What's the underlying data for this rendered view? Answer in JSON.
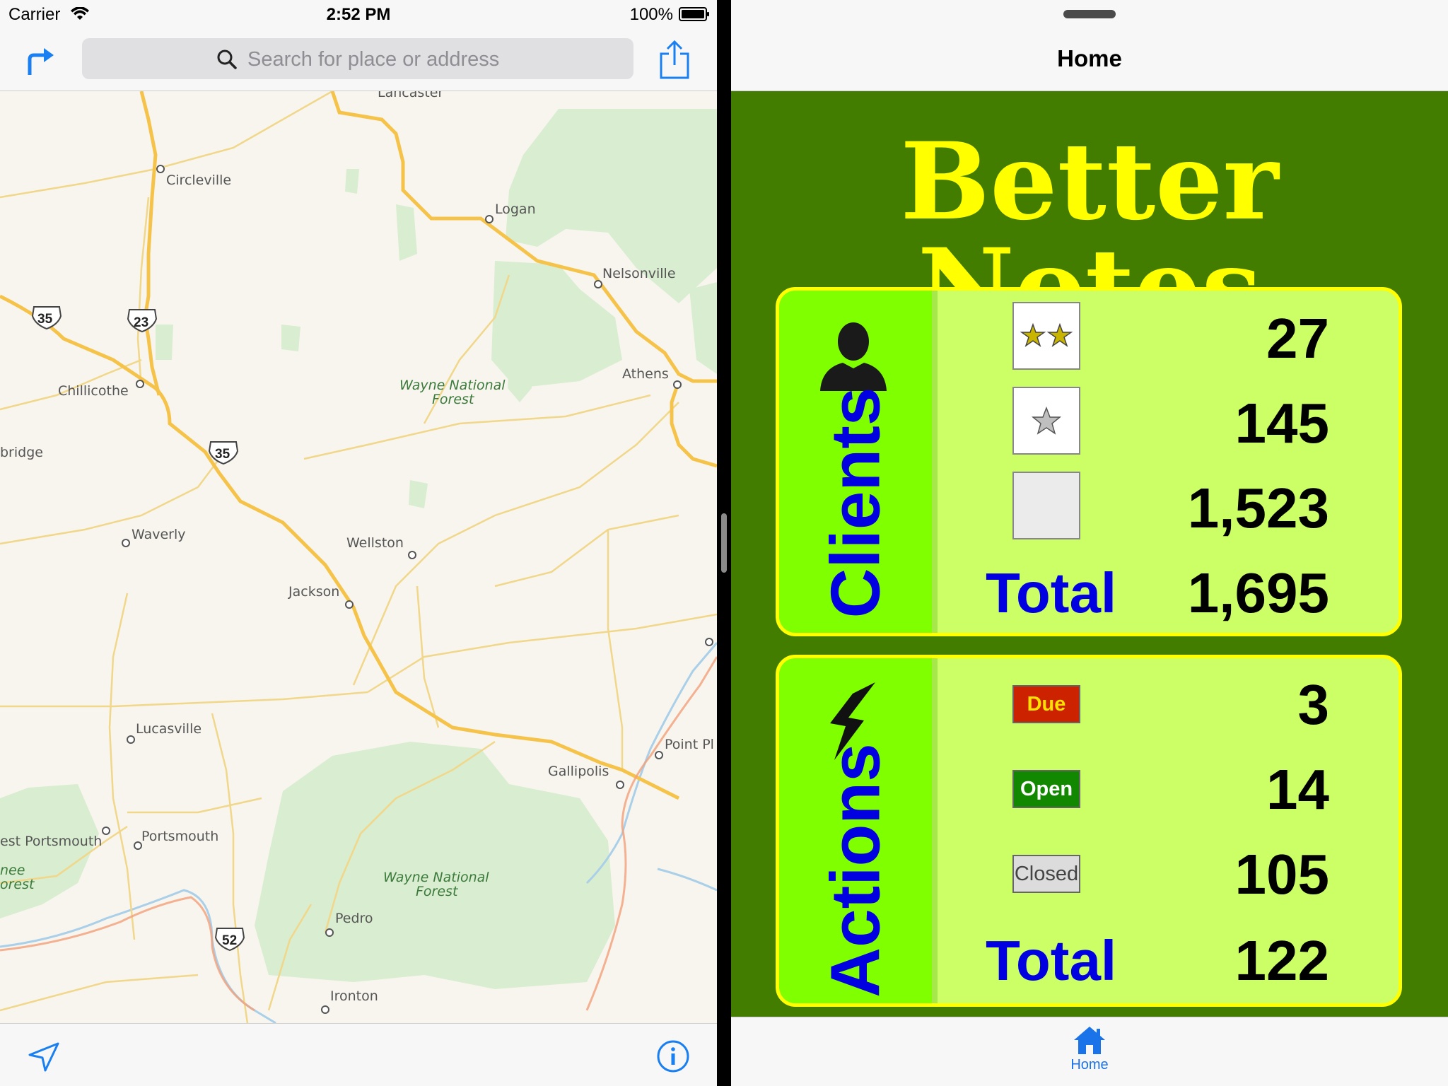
{
  "status_bar": {
    "carrier": "Carrier",
    "time": "2:52 PM",
    "battery": "100%"
  },
  "maps": {
    "search_placeholder": "Search for place or address",
    "places": {
      "lancaster": "Lancaster",
      "circleville": "Circleville",
      "logan": "Logan",
      "nelsonville": "Nelsonville",
      "chillicothe": "Chillicothe",
      "athens": "Athens",
      "bridge": "bridge",
      "waverly": "Waverly",
      "wellston": "Wellston",
      "jackson": "Jackson",
      "lucasville": "Lucasville",
      "point": "Point Pl",
      "gallipolis": "Gallipolis",
      "west_portsmouth": "est Portsmouth",
      "portsmouth": "Portsmouth",
      "pedro": "Pedro",
      "ironton": "Ironton",
      "nee": "nee",
      "orest": "orest"
    },
    "forests": {
      "north_line1": "Wayne National",
      "north_line2": "Forest",
      "south_line1": "Wayne National",
      "south_line2": "Forest"
    },
    "shields": {
      "r35a": "35",
      "r23": "23",
      "r35b": "35",
      "r52": "52"
    },
    "colors": {
      "land": "#f8f5ee",
      "forest": "#d9edd0",
      "highway": "#f6c34a",
      "water": "#aacfe8"
    }
  },
  "app": {
    "nav_title": "Home",
    "title": "Better Notes",
    "clients": {
      "label": "Clients",
      "rows": [
        {
          "kind": "two-stars",
          "value": "27"
        },
        {
          "kind": "one-star",
          "value": "145"
        },
        {
          "kind": "no-star",
          "value": "1,523"
        }
      ],
      "total_label": "Total",
      "total_value": "1,695"
    },
    "actions": {
      "label": "Actions",
      "rows": [
        {
          "tag": "Due",
          "value": "3"
        },
        {
          "tag": "Open",
          "value": "14"
        },
        {
          "tag": "Closed",
          "value": "105"
        }
      ],
      "total_label": "Total",
      "total_value": "122"
    },
    "tab_bar": {
      "home_label": "Home"
    },
    "colors": {
      "background": "#437d00",
      "title": "#ffff00",
      "panel": "#ccff66",
      "side": "#80ff00",
      "label": "#0000e0"
    }
  }
}
